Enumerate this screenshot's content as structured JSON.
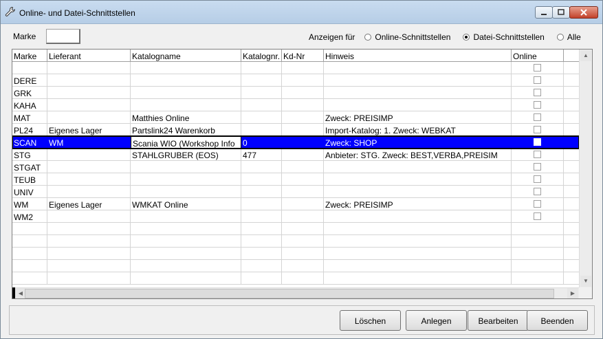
{
  "window": {
    "title": "Online- und Datei-Schnittstellen"
  },
  "filter": {
    "marke_label": "Marke",
    "marke_value": "",
    "anzeigen_label": "Anzeigen für",
    "options": [
      {
        "label": "Online-Schnittstellen",
        "selected": false
      },
      {
        "label": "Datei-Schnittstellen",
        "selected": true
      },
      {
        "label": "Alle",
        "selected": false
      }
    ]
  },
  "table": {
    "columns": [
      "Marke",
      "Lieferant",
      "Katalogname",
      "Katalognr.",
      "Kd-Nr",
      "Hinweis",
      "Online"
    ],
    "rows": [
      {
        "marke": "",
        "lieferant": "",
        "katalogname": "",
        "katalognr": "",
        "kdnr": "",
        "hinweis": "",
        "online": false
      },
      {
        "marke": "DERE",
        "lieferant": "",
        "katalogname": "",
        "katalognr": "",
        "kdnr": "",
        "hinweis": "",
        "online": false
      },
      {
        "marke": "GRK",
        "lieferant": "",
        "katalogname": "",
        "katalognr": "",
        "kdnr": "",
        "hinweis": "",
        "online": false
      },
      {
        "marke": "KAHA",
        "lieferant": "",
        "katalogname": "",
        "katalognr": "",
        "kdnr": "",
        "hinweis": "",
        "online": false
      },
      {
        "marke": "MAT",
        "lieferant": "",
        "katalogname": "Matthies Online",
        "katalognr": "",
        "kdnr": "",
        "hinweis": "Zweck: PREISIMP",
        "online": false
      },
      {
        "marke": "PL24",
        "lieferant": "Eigenes Lager",
        "katalogname": "Partslink24 Warenkorb",
        "katalognr": "",
        "kdnr": "",
        "hinweis": "Import-Katalog: 1. Zweck: WEBKAT",
        "online": false
      },
      {
        "marke": "SCAN",
        "lieferant": "WM",
        "katalogname": "Scania WIO (Workshop Info",
        "katalognr": "0",
        "kdnr": "",
        "hinweis": "Zweck: SHOP",
        "online": false,
        "selected": true
      },
      {
        "marke": "STG",
        "lieferant": "",
        "katalogname": "STAHLGRUBER (EOS)",
        "katalognr": "477",
        "kdnr": "",
        "hinweis": "Anbieter: STG. Zweck: BEST,VERBA,PREISIM",
        "online": false
      },
      {
        "marke": "STGAT",
        "lieferant": "",
        "katalogname": "",
        "katalognr": "",
        "kdnr": "",
        "hinweis": "",
        "online": false
      },
      {
        "marke": "TEUB",
        "lieferant": "",
        "katalogname": "",
        "katalognr": "",
        "kdnr": "",
        "hinweis": "",
        "online": false
      },
      {
        "marke": "UNIV",
        "lieferant": "",
        "katalogname": "",
        "katalognr": "",
        "kdnr": "",
        "hinweis": "",
        "online": false
      },
      {
        "marke": "WM",
        "lieferant": "Eigenes Lager",
        "katalogname": "WMKAT Online",
        "katalognr": "",
        "kdnr": "",
        "hinweis": "Zweck: PREISIMP",
        "online": false
      },
      {
        "marke": "WM2",
        "lieferant": "",
        "katalogname": "",
        "katalognr": "",
        "kdnr": "",
        "hinweis": "",
        "online": false
      }
    ]
  },
  "buttons": {
    "loeschen": "Löschen",
    "anlegen": "Anlegen",
    "bearbeiten": "Bearbeiten",
    "beenden": "Beenden"
  }
}
